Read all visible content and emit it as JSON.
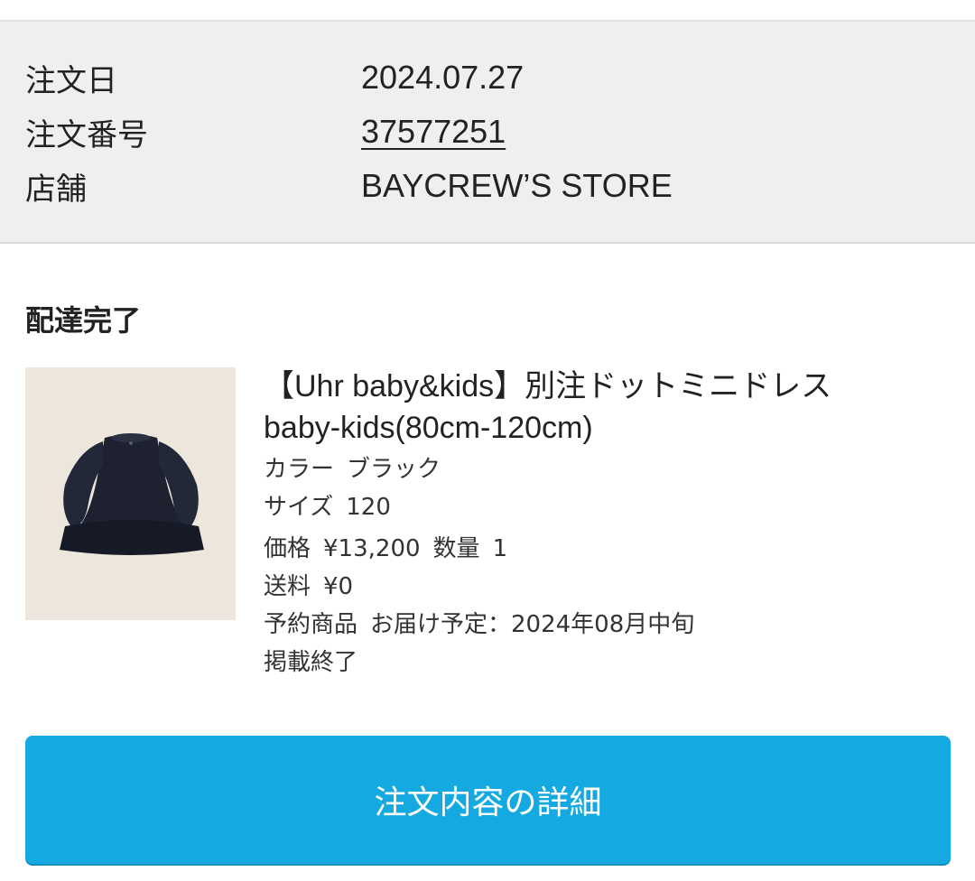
{
  "summary": {
    "order_date_label": "注文日",
    "order_date_value": "2024.07.27",
    "order_number_label": "注文番号",
    "order_number_value": "37577251",
    "store_label": "店舗",
    "store_value": "BAYCREW’S STORE"
  },
  "status": "配達完了",
  "product": {
    "image_icon": "black-dress-photo",
    "name_line1": "【Uhr baby&kids】別注ドットミニドレス",
    "name_line2": "baby-kids(80cm-120cm)",
    "color_label": "カラー",
    "color_value": "ブラック",
    "size_label": "サイズ",
    "size_value": "120",
    "price_label": "価格",
    "price_value": "¥13,200",
    "quantity_label": "数量",
    "quantity_value": "1",
    "shipping_label": "送料",
    "shipping_value": "¥0",
    "preorder_label": "予約商品",
    "delivery_text": "お届け予定：2024年08月中旬",
    "listing_status": "掲載終了"
  },
  "actions": {
    "detail_button_label": "注文内容の詳細",
    "button_color": "#14a9e0"
  }
}
